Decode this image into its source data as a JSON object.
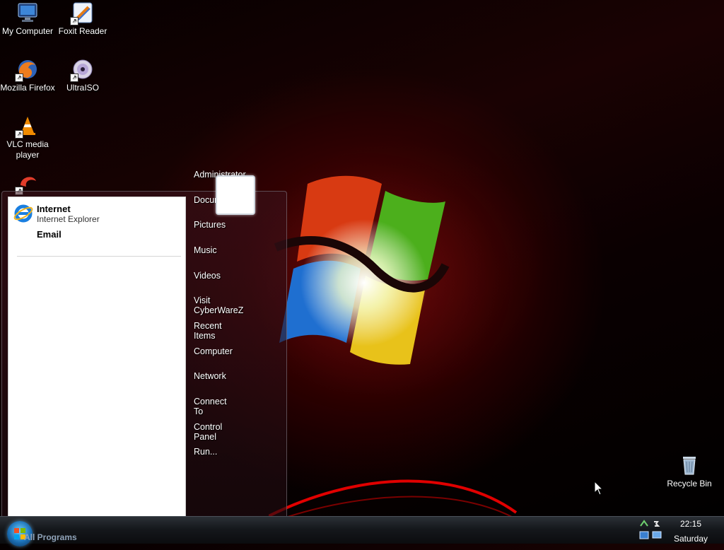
{
  "desktop": {
    "icons": [
      {
        "label": "My Computer",
        "icon": "computer-icon"
      },
      {
        "label": "Foxit Reader",
        "icon": "pdf-reader-icon"
      },
      {
        "label": "Mozilla Firefox",
        "icon": "firefox-icon"
      },
      {
        "label": "UltraISO",
        "icon": "disc-icon"
      },
      {
        "label": "VLC media player",
        "icon": "vlc-cone-icon"
      },
      {
        "label": "Recycle Bin",
        "icon": "recycle-bin-icon"
      }
    ]
  },
  "start_menu": {
    "pinned": [
      {
        "title": "Internet",
        "subtitle": "Internet Explorer",
        "icon": "internet-explorer-icon"
      },
      {
        "title": "Email",
        "subtitle": ""
      }
    ],
    "right_links": [
      "Administrator",
      "Documents",
      "Pictures",
      "Music",
      "Videos",
      "Visit CyberWareZ",
      "Recent Items",
      "Computer",
      "Network",
      "Connect To",
      "Control Panel",
      "Run..."
    ],
    "all_programs": "All Programs"
  },
  "taskbar": {
    "time": "22:15",
    "day": "Saturday"
  },
  "colors": {
    "accent_red": "#c80000",
    "menu_bg": "#ffffff",
    "taskbar": "#15181c"
  }
}
